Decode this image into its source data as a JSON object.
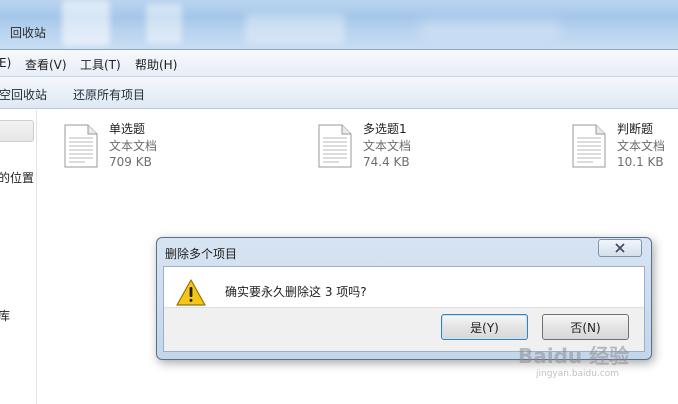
{
  "window": {
    "title": "回收站"
  },
  "menubar": {
    "items": [
      {
        "label": "E)"
      },
      {
        "label": "查看(V)"
      },
      {
        "label": "工具(T)"
      },
      {
        "label": "帮助(H)"
      }
    ]
  },
  "commandbar": {
    "empty_label": "空回收站",
    "restore_all_label": "还原所有项目"
  },
  "navpane": {
    "items": [
      {
        "label": "的位置"
      },
      {
        "label": "库"
      }
    ]
  },
  "files": [
    {
      "name": "单选题",
      "type": "文本文档",
      "size": "709 KB",
      "icon": "text-file-icon"
    },
    {
      "name": "多选题1",
      "type": "文本文档",
      "size": "74.4 KB",
      "icon": "text-file-icon"
    },
    {
      "name": "判断题",
      "type": "文本文档",
      "size": "10.1 KB",
      "icon": "text-file-icon"
    }
  ],
  "dialog": {
    "title": "删除多个项目",
    "message": "确实要永久删除这 3 项吗?",
    "yes_label": "是(Y)",
    "no_label": "否(N)",
    "icon": "warning-icon",
    "close_icon": "close-icon"
  },
  "watermark": {
    "text": "Baidu 经验",
    "sub": "jingyan.baidu.com"
  },
  "colors": {
    "titlebar": "#a6c7ea",
    "menubar": "#e8eef7",
    "dialog_frame": "#c4d6ea",
    "dialog_footer": "#f0f0f0",
    "warning": "#f5c518"
  }
}
